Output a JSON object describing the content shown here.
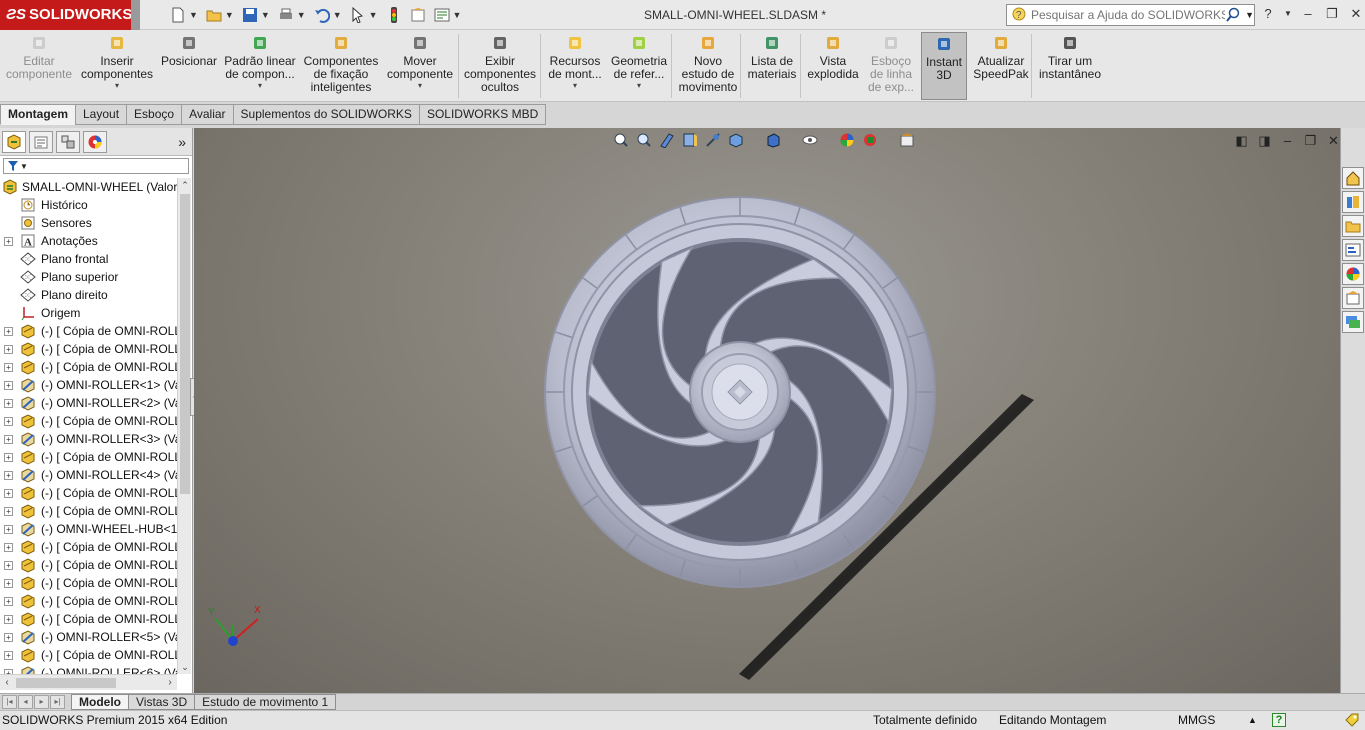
{
  "titlebar": {
    "brand": "SOLIDWORKS",
    "document_title": "SMALL-OMNI-WHEEL.SLDASM *",
    "search_placeholder": "Pesquisar a Ajuda do SOLIDWORKS",
    "help_label": "?"
  },
  "commands": [
    {
      "label1": "Editar",
      "label2": "componente",
      "label3": "",
      "disabled": true,
      "dropdown": false,
      "icon": "edit-component-icon"
    },
    {
      "label1": "Inserir",
      "label2": "componentes",
      "label3": "",
      "disabled": false,
      "dropdown": true,
      "icon": "insert-components-icon"
    },
    {
      "label1": "Posicionar",
      "label2": "",
      "label3": "",
      "disabled": false,
      "dropdown": false,
      "icon": "mate-icon"
    },
    {
      "label1": "Padrão linear",
      "label2": "de compon...",
      "label3": "",
      "disabled": false,
      "dropdown": true,
      "icon": "linear-pattern-icon"
    },
    {
      "label1": "Componentes",
      "label2": "de fixação",
      "label3": "inteligentes",
      "disabled": false,
      "dropdown": false,
      "icon": "smart-fasteners-icon"
    },
    {
      "label1": "Mover",
      "label2": "componente",
      "label3": "",
      "disabled": false,
      "dropdown": true,
      "icon": "move-component-icon"
    },
    {
      "label1": "Exibir",
      "label2": "componentes",
      "label3": "ocultos",
      "disabled": false,
      "dropdown": false,
      "icon": "show-hidden-icon"
    },
    {
      "label1": "Recursos",
      "label2": "de mont...",
      "label3": "",
      "disabled": false,
      "dropdown": true,
      "icon": "assembly-features-icon"
    },
    {
      "label1": "Geometria",
      "label2": "de refer...",
      "label3": "",
      "disabled": false,
      "dropdown": true,
      "icon": "reference-geometry-icon"
    },
    {
      "label1": "Novo",
      "label2": "estudo de",
      "label3": "movimento",
      "disabled": false,
      "dropdown": false,
      "icon": "motion-study-icon"
    },
    {
      "label1": "Lista de",
      "label2": "materiais",
      "label3": "",
      "disabled": false,
      "dropdown": false,
      "icon": "bom-icon"
    },
    {
      "label1": "Vista",
      "label2": "explodida",
      "label3": "",
      "disabled": false,
      "dropdown": false,
      "icon": "exploded-view-icon"
    },
    {
      "label1": "Esboço",
      "label2": "de linha",
      "label3": "de exp...",
      "disabled": true,
      "dropdown": false,
      "icon": "explode-line-icon"
    },
    {
      "label1": "Instant",
      "label2": "3D",
      "label3": "",
      "disabled": false,
      "dropdown": false,
      "active": true,
      "icon": "instant3d-icon"
    },
    {
      "label1": "Atualizar",
      "label2": "SpeedPak",
      "label3": "",
      "disabled": false,
      "dropdown": false,
      "icon": "speedpak-icon"
    },
    {
      "label1": "Tirar um",
      "label2": "instantâneo",
      "label3": "",
      "disabled": false,
      "dropdown": false,
      "icon": "snapshot-icon"
    }
  ],
  "tabs": [
    "Montagem",
    "Layout",
    "Esboço",
    "Avaliar",
    "Suplementos do SOLIDWORKS",
    "SOLIDWORKS MBD"
  ],
  "active_tab": "Montagem",
  "tree": {
    "root": "SMALL-OMNI-WHEEL  (Valor",
    "items": [
      {
        "label": "Histórico",
        "icon": "history-icon",
        "expand": false
      },
      {
        "label": "Sensores",
        "icon": "sensor-icon",
        "expand": false
      },
      {
        "label": "Anotações",
        "icon": "annotation-icon",
        "expand": true
      },
      {
        "label": "Plano frontal",
        "icon": "plane-icon",
        "expand": false
      },
      {
        "label": "Plano superior",
        "icon": "plane-icon",
        "expand": false
      },
      {
        "label": "Plano direito",
        "icon": "plane-icon",
        "expand": false
      },
      {
        "label": "Origem",
        "icon": "origin-icon",
        "expand": false
      },
      {
        "label": "(-) [ Cópia de OMNI-ROLL",
        "icon": "part-icon",
        "expand": true
      },
      {
        "label": "(-) [ Cópia de OMNI-ROLL",
        "icon": "part-icon",
        "expand": true
      },
      {
        "label": "(-) [ Cópia de OMNI-ROLL",
        "icon": "part-icon",
        "expand": true
      },
      {
        "label": "(-) OMNI-ROLLER<1> (Va",
        "icon": "part-blue-icon",
        "expand": true
      },
      {
        "label": "(-) OMNI-ROLLER<2> (Va",
        "icon": "part-blue-icon",
        "expand": true
      },
      {
        "label": "(-) [ Cópia de OMNI-ROLL",
        "icon": "part-icon",
        "expand": true
      },
      {
        "label": "(-) OMNI-ROLLER<3> (Va",
        "icon": "part-blue-icon",
        "expand": true
      },
      {
        "label": "(-) [ Cópia de OMNI-ROLL",
        "icon": "part-icon",
        "expand": true
      },
      {
        "label": "(-) OMNI-ROLLER<4> (Va",
        "icon": "part-blue-icon",
        "expand": true
      },
      {
        "label": "(-) [ Cópia de OMNI-ROLL",
        "icon": "part-icon",
        "expand": true
      },
      {
        "label": "(-) [ Cópia de OMNI-ROLL",
        "icon": "part-icon",
        "expand": true
      },
      {
        "label": "(-) OMNI-WHEEL-HUB<1",
        "icon": "part-blue-icon",
        "expand": true
      },
      {
        "label": "(-) [ Cópia de OMNI-ROLL",
        "icon": "part-icon",
        "expand": true
      },
      {
        "label": "(-) [ Cópia de OMNI-ROLL",
        "icon": "part-icon",
        "expand": true
      },
      {
        "label": "(-) [ Cópia de OMNI-ROLL",
        "icon": "part-icon",
        "expand": true
      },
      {
        "label": "(-) [ Cópia de OMNI-ROLL",
        "icon": "part-icon",
        "expand": true
      },
      {
        "label": "(-) [ Cópia de OMNI-ROLL",
        "icon": "part-icon",
        "expand": true
      },
      {
        "label": "(-) OMNI-ROLLER<5> (Va",
        "icon": "part-blue-icon",
        "expand": true
      },
      {
        "label": "(-) [ Cópia de OMNI-ROLL",
        "icon": "part-icon",
        "expand": true
      },
      {
        "label": "(-) OMNI-ROLLER<6> (Va",
        "icon": "part-blue-icon",
        "expand": true
      }
    ]
  },
  "bottom_tabs": [
    "Modelo",
    "Vistas 3D",
    "Estudo de movimento 1"
  ],
  "active_bottom_tab": "Modelo",
  "triad": {
    "x": "X",
    "y": "Y"
  },
  "status": {
    "edition": "SOLIDWORKS Premium 2015 x64 Edition",
    "definition": "Totalmente definido",
    "mode": "Editando Montagem",
    "units": "MMGS",
    "help": "?"
  },
  "colors": {
    "brand": "#c41a1a",
    "viewport": "#858178",
    "part": "#c9ccdc"
  }
}
